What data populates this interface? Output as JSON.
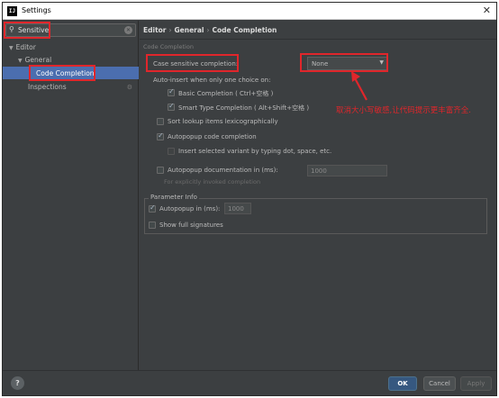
{
  "window": {
    "title": "Settings",
    "app_icon_text": "IJ"
  },
  "sidebar": {
    "search": {
      "value": "Sensitive"
    },
    "tree": [
      {
        "label": "Editor"
      },
      {
        "label": "General"
      },
      {
        "label": "Code Completion"
      },
      {
        "label": "Inspections"
      }
    ]
  },
  "breadcrumb": {
    "items": [
      "Editor",
      "General",
      "Code Completion"
    ],
    "separator": "›"
  },
  "settings": {
    "section_title": "Code Completion",
    "case_sensitive_label": "Case sensitive completion:",
    "case_sensitive_value": "None",
    "auto_insert_label": "Auto-insert when only one choice on:",
    "basic_completion": {
      "label": "Basic Completion ( Ctrl+空格 )",
      "checked": true
    },
    "smart_type_completion": {
      "label": "Smart Type Completion ( Alt+Shift+空格 )",
      "checked": true
    },
    "sort_lookup": {
      "label": "Sort lookup items lexicographically",
      "checked": false
    },
    "autopopup_code": {
      "label": "Autopopup code completion",
      "checked": true
    },
    "insert_selected": {
      "label": "Insert selected variant by typing dot, space, etc.",
      "checked": false
    },
    "autopopup_doc": {
      "label": "Autopopup documentation in (ms):",
      "checked": false,
      "value": "1000",
      "hint": "For explicitly invoked completion"
    },
    "parameter_info": {
      "title": "Parameter Info",
      "autopopup": {
        "label": "Autopopup in (ms):",
        "checked": true,
        "value": "1000"
      },
      "full_signatures": {
        "label": "Show full signatures",
        "checked": false
      }
    }
  },
  "annotation": {
    "text": "取消大小写敏感,让代码提示更丰富齐全.",
    "color": "#e0262b"
  },
  "footer": {
    "help": "?",
    "ok": "OK",
    "cancel": "Cancel",
    "apply": "Apply"
  }
}
